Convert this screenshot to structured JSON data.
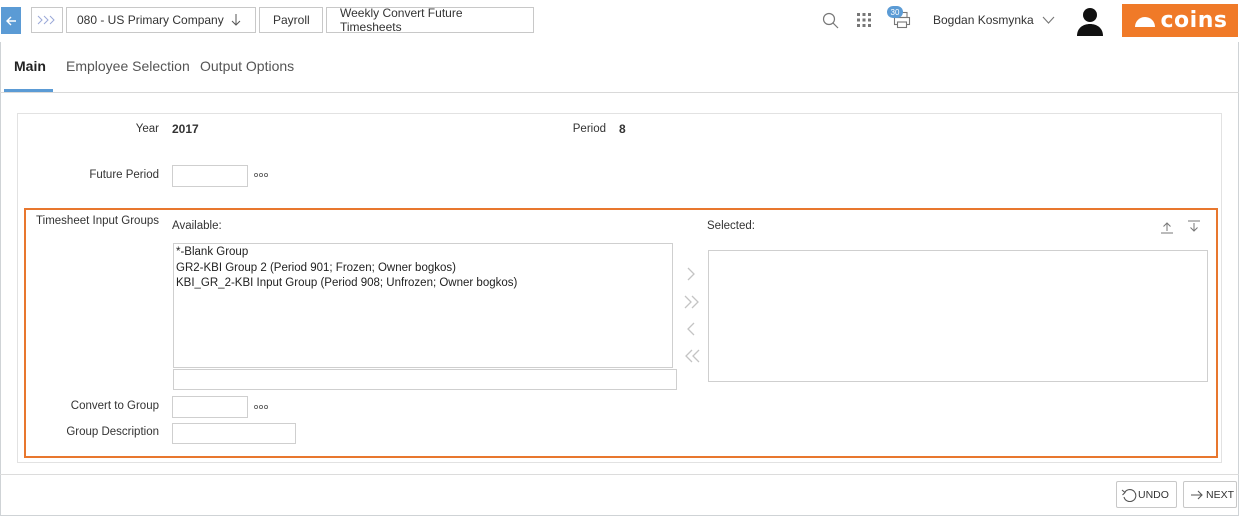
{
  "header": {
    "breadcrumbs": [
      {
        "label": "080 - US Primary Company"
      },
      {
        "label": "Payroll"
      },
      {
        "label": "Weekly Convert Future Timesheets"
      }
    ],
    "notifications_count": "30",
    "user_name": "Bogdan Kosmynka",
    "brand": "coins",
    "icons": [
      "back-arrow-icon",
      "chevrons-right-icon",
      "search-icon",
      "apps-grid-icon",
      "printer-icon",
      "chevron-down-icon",
      "user-avatar-icon"
    ]
  },
  "tabs": [
    {
      "label": "Main",
      "active": true
    },
    {
      "label": "Employee Selection",
      "active": false
    },
    {
      "label": "Output Options",
      "active": false
    }
  ],
  "form": {
    "year_label": "Year",
    "year_value": "2017",
    "period_label": "Period",
    "period_value": "8",
    "future_period_label": "Future Period",
    "future_period_value": "",
    "groups_label": "Timesheet Input Groups",
    "available_label": "Available:",
    "selected_label": "Selected:",
    "available_items": [
      "*-Blank Group",
      "GR2-KBI Group 2 (Period 901; Frozen; Owner bogkos)",
      "KBI_GR_2-KBI Input Group (Period 908; Unfrozen; Owner bogkos)"
    ],
    "selected_items": [],
    "filter_value": "",
    "convert_to_group_label": "Convert to Group",
    "convert_to_group_value": "",
    "group_description_label": "Group Description",
    "group_description_value": ""
  },
  "footer": {
    "undo_label": "UNDO",
    "next_label": "NEXT"
  },
  "colors": {
    "accent": "#5b9bd5",
    "brand": "#f07a28",
    "highlight_border": "#e8772e"
  }
}
